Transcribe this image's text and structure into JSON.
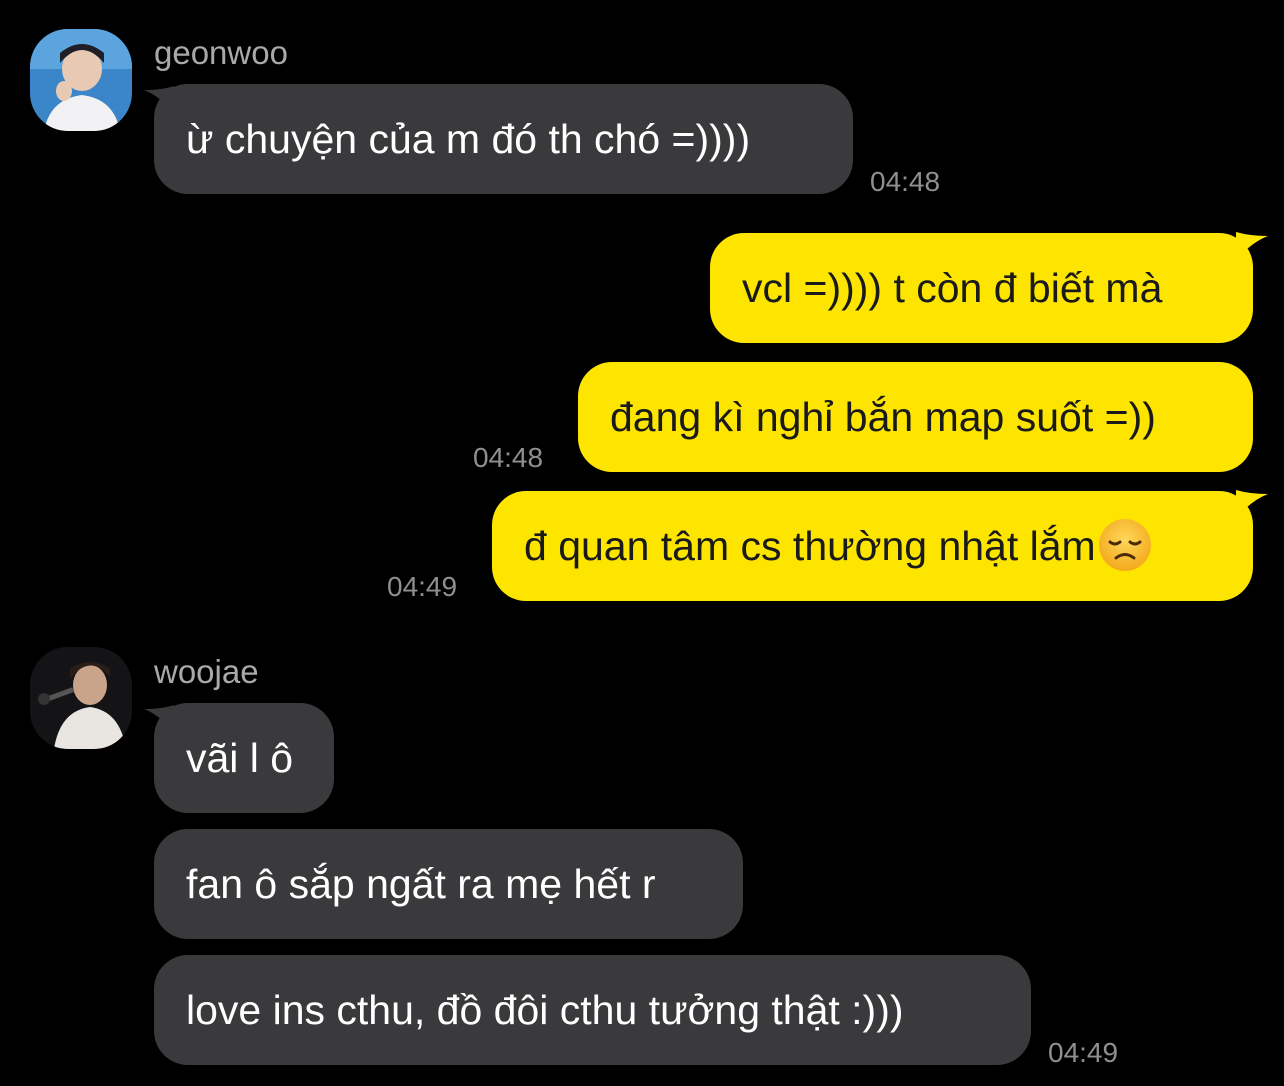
{
  "messages": [
    {
      "sender": "geonwoo",
      "time": "04:48",
      "text": "ừ chuyện của m đó th chó =))))"
    },
    {
      "sender": "me",
      "bubbles": [
        {
          "text": "vcl =)))) t còn đ biết mà"
        },
        {
          "text": "đang kì nghỉ bắn map suốt =))",
          "time": "04:48"
        },
        {
          "text": "đ quan tâm cs thường nhật lắm",
          "emoji": "disappointed-face-icon",
          "time": "04:49"
        }
      ]
    },
    {
      "sender": "woojae",
      "bubbles": [
        {
          "text": "vãi l ô"
        },
        {
          "text": "fan ô sắp ngất ra mẹ hết r"
        },
        {
          "text": "love ins cthu, đồ đôi cthu tưởng thật :)))",
          "time": "04:49"
        }
      ]
    }
  ],
  "colors": {
    "background": "#000000",
    "incoming_bubble": "#3a3a3c",
    "outgoing_bubble": "#fde500",
    "timestamp": "#8f8f8f",
    "sender_name": "#a9a9a9"
  }
}
